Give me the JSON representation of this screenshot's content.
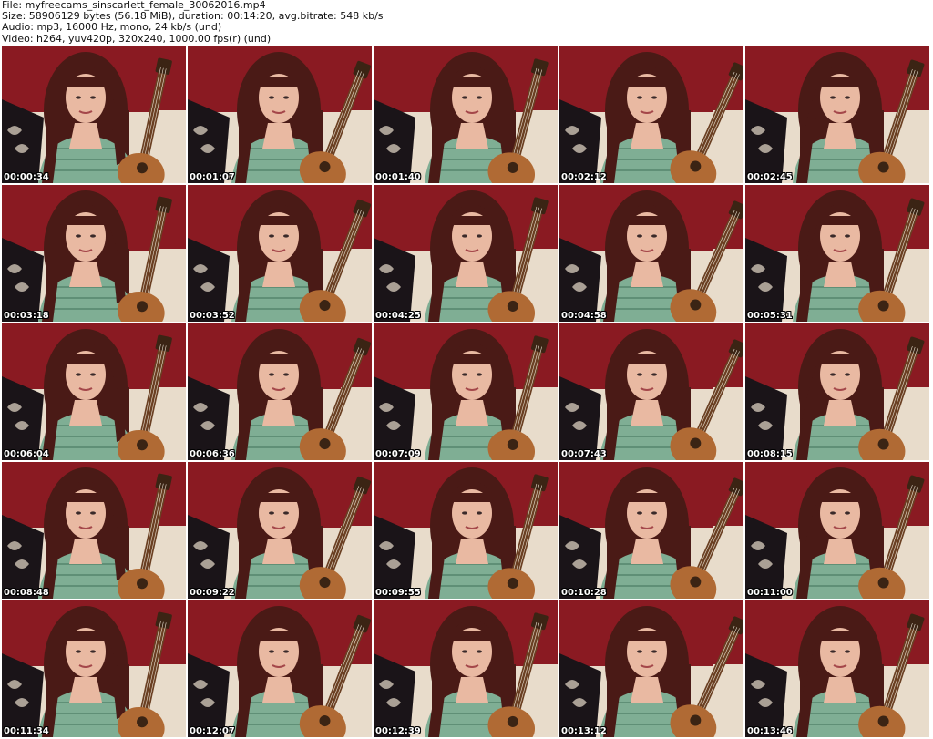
{
  "header": {
    "file_line": "File: myfreecams_sinscarlett_female_30062016.mp4",
    "size_line": "Size: 58906129 bytes (56.18 MiB), duration: 00:14:20, avg.bitrate: 548 kb/s",
    "audio_line": "Audio: mp3, 16000 Hz, mono, 24 kb/s (und)",
    "video_line": "Video: h264, yuv420p, 320x240, 1000.00 fps(r) (und)"
  },
  "colors": {
    "wall": "#8a1a22",
    "pillow_dark": "#1a1418",
    "pillow_light": "#e8dccb",
    "hair": "#4a1a16",
    "skin": "#e9b9a2",
    "shirt": "#7fae94",
    "ukulele": "#b06a34",
    "ukulele_neck": "#6a3f22"
  },
  "thumbnails": [
    {
      "timestamp": "00:00:34",
      "thumbnail_icon": "ukulele-player-frame"
    },
    {
      "timestamp": "00:01:07",
      "thumbnail_icon": "ukulele-player-frame"
    },
    {
      "timestamp": "00:01:40",
      "thumbnail_icon": "ukulele-player-frame"
    },
    {
      "timestamp": "00:02:12",
      "thumbnail_icon": "ukulele-player-frame"
    },
    {
      "timestamp": "00:02:45",
      "thumbnail_icon": "ukulele-player-frame"
    },
    {
      "timestamp": "00:03:18",
      "thumbnail_icon": "ukulele-player-frame"
    },
    {
      "timestamp": "00:03:52",
      "thumbnail_icon": "ukulele-player-frame"
    },
    {
      "timestamp": "00:04:25",
      "thumbnail_icon": "ukulele-player-frame"
    },
    {
      "timestamp": "00:04:58",
      "thumbnail_icon": "ukulele-player-frame"
    },
    {
      "timestamp": "00:05:31",
      "thumbnail_icon": "ukulele-player-frame"
    },
    {
      "timestamp": "00:06:04",
      "thumbnail_icon": "ukulele-player-frame"
    },
    {
      "timestamp": "00:06:36",
      "thumbnail_icon": "ukulele-player-frame"
    },
    {
      "timestamp": "00:07:09",
      "thumbnail_icon": "ukulele-player-frame"
    },
    {
      "timestamp": "00:07:43",
      "thumbnail_icon": "ukulele-player-frame"
    },
    {
      "timestamp": "00:08:15",
      "thumbnail_icon": "ukulele-player-frame"
    },
    {
      "timestamp": "00:08:48",
      "thumbnail_icon": "ukulele-player-frame"
    },
    {
      "timestamp": "00:09:22",
      "thumbnail_icon": "ukulele-player-frame"
    },
    {
      "timestamp": "00:09:55",
      "thumbnail_icon": "ukulele-player-frame"
    },
    {
      "timestamp": "00:10:28",
      "thumbnail_icon": "ukulele-player-frame"
    },
    {
      "timestamp": "00:11:00",
      "thumbnail_icon": "ukulele-player-frame"
    },
    {
      "timestamp": "00:11:34",
      "thumbnail_icon": "ukulele-player-frame"
    },
    {
      "timestamp": "00:12:07",
      "thumbnail_icon": "ukulele-player-frame"
    },
    {
      "timestamp": "00:12:39",
      "thumbnail_icon": "ukulele-player-frame"
    },
    {
      "timestamp": "00:13:12",
      "thumbnail_icon": "ukulele-player-frame"
    },
    {
      "timestamp": "00:13:46",
      "thumbnail_icon": "ukulele-player-frame"
    }
  ]
}
